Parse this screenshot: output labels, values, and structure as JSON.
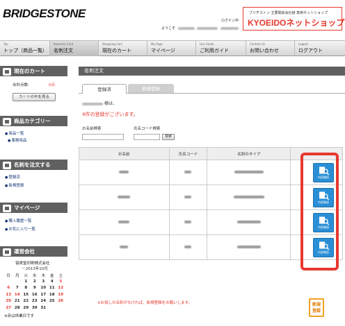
{
  "header": {
    "logo": "BRIDGESTONE",
    "login_label": "ログイン中",
    "welcome_label": "ようこそ",
    "brand_sub": "ブリヂストン 主要関係会社様 専用ネットショップ",
    "brand_main": "KYOEIDOネットショップ"
  },
  "nav": [
    {
      "en": "Top",
      "jp": "トップ（商品一覧）"
    },
    {
      "en": "Business Card",
      "jp": "名刺注文"
    },
    {
      "en": "Shopping Cart",
      "jp": "現在のカート"
    },
    {
      "en": "My Page",
      "jp": "マイページ"
    },
    {
      "en": "Use Guide",
      "jp": "ご利用ガイド"
    },
    {
      "en": "Contact Us",
      "jp": "お問い合わせ"
    },
    {
      "en": "Logout",
      "jp": "ログアウト"
    }
  ],
  "sidebar": {
    "cart": {
      "title": "現在のカート",
      "total_label": "合計点数:",
      "total_value": "0点",
      "view_button": "カートの中を見る"
    },
    "category": {
      "title": "商品カテゴリー",
      "items": [
        "商品一覧",
        "事務用品"
      ]
    },
    "cards": {
      "title": "名刺を注文する",
      "items": [
        "登録済",
        "新規登録"
      ]
    },
    "mypage": {
      "title": "マイページ",
      "items": [
        "購入履歴一覧",
        "お気に入り一覧"
      ]
    },
    "company": {
      "title": "運営会社",
      "name": "協栄堂印刷株式会社",
      "month": "－2013年10月",
      "weekdays": [
        "日",
        "月",
        "火",
        "水",
        "木",
        "金",
        "土"
      ],
      "weeks": [
        [
          "",
          "",
          "1",
          "2",
          "3",
          "4",
          "5"
        ],
        [
          "6",
          "7",
          "8",
          "9",
          "10",
          "11",
          "12"
        ],
        [
          "13",
          "14",
          "15",
          "16",
          "17",
          "18",
          "19"
        ],
        [
          "20",
          "21",
          "22",
          "23",
          "24",
          "25",
          "26"
        ],
        [
          "27",
          "28",
          "29",
          "30",
          "31",
          "",
          ""
        ]
      ],
      "holiday_note": "※赤は休業日です",
      "holiday_color": "#e8382e"
    }
  },
  "main": {
    "title": "名刺注文",
    "tabs": [
      "登録済",
      "新規登録"
    ],
    "greeting_suffix": "様は、",
    "count_message": "4件の登録がございます。",
    "search": {
      "name_label": "お名前検索",
      "code_label": "氏名コード検索",
      "button": "検索"
    },
    "table": {
      "headers": [
        "お名前",
        "氏名コード",
        "名刺のタイプ",
        ""
      ],
      "detail_button": "内容確認"
    },
    "note": "※お探しの名刺がなければ、新規登録をお願いします。",
    "new_button": [
      "新規",
      "登録"
    ]
  },
  "colors": {
    "accent": "#e8382e",
    "header_bg": "#606060",
    "button_blue": "#2a8fd6",
    "orange": "#f0a020"
  }
}
